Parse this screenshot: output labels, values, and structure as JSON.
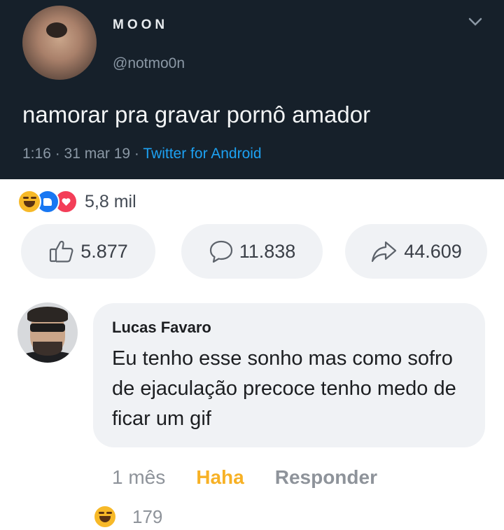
{
  "tweet": {
    "display_name": "MOON",
    "handle": "@notmo0n",
    "text": "namorar pra gravar pornô amador",
    "time": "1:16 · 31 mar 19 · ",
    "source": "Twitter for Android",
    "avatar_icon": "spider-avatar-icon",
    "menu_icon": "chevron-down-icon",
    "colors": {
      "background": "#16202a",
      "muted": "#8b98a5",
      "link": "#1da1f2"
    }
  },
  "post": {
    "reaction_icons": [
      "haha-icon",
      "like-icon",
      "love-icon"
    ],
    "reaction_count": "5,8 mil",
    "actions": {
      "like_count": "5.877",
      "comment_count": "11.838",
      "share_count": "44.609"
    },
    "colors": {
      "haha": "#f7b928",
      "like": "#1877f2",
      "love": "#f33e58"
    }
  },
  "comment": {
    "author": "Lucas Favaro",
    "text": "Eu tenho esse sonho mas como sofro de ejaculação precoce tenho medo de ficar um gif",
    "time": "1 mês",
    "reaction_label": "Haha",
    "reply_label": "Responder",
    "reaction_count": "179",
    "colors": {
      "haha_label": "#f7b125",
      "muted": "#8e939a"
    }
  }
}
